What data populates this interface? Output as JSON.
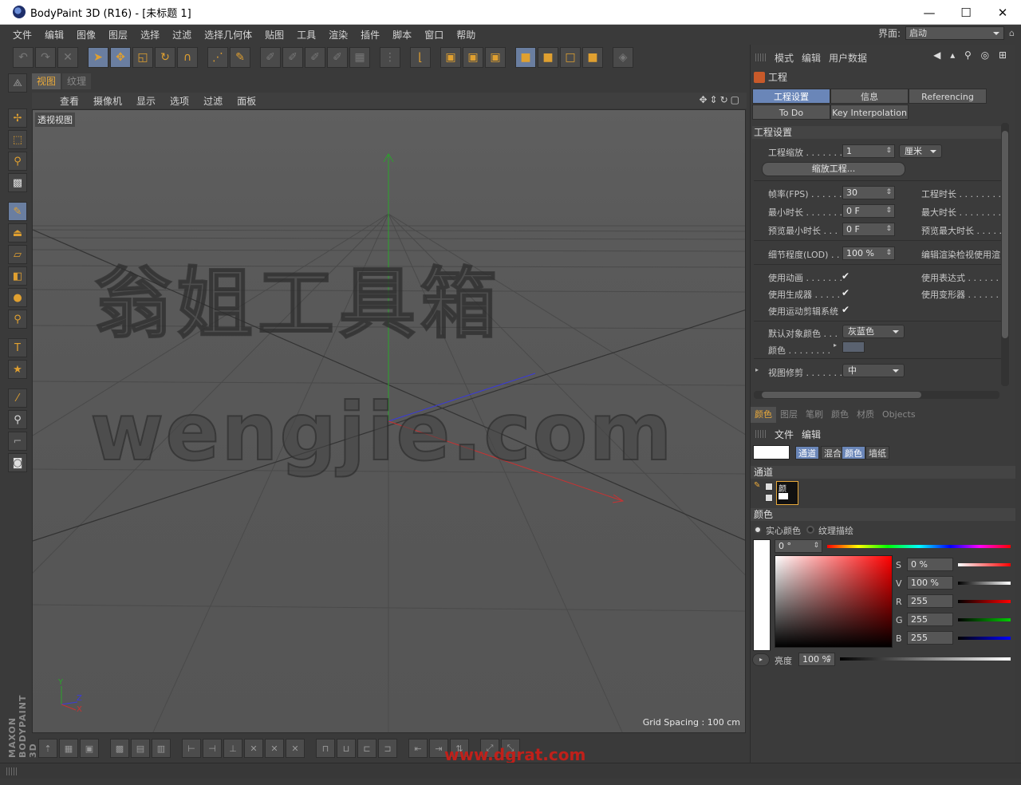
{
  "window": {
    "title": "BodyPaint 3D (R16) - [未标题 1]",
    "minimize": "—",
    "maximize": "☐",
    "close": "✕"
  },
  "menu": [
    "文件",
    "编辑",
    "图像",
    "图层",
    "选择",
    "过滤",
    "选择几何体",
    "贴图",
    "工具",
    "渲染",
    "插件",
    "脚本",
    "窗口",
    "帮助"
  ],
  "layout": {
    "label": "界面:",
    "value": "启动"
  },
  "viewport": {
    "tabs": [
      "视图",
      "纹理"
    ],
    "menu": [
      "查看",
      "摄像机",
      "显示",
      "选项",
      "过滤",
      "面板"
    ],
    "view_label": "透视视图",
    "grid_info": "Grid Spacing : 100 cm",
    "axis": {
      "y": "Y",
      "z": "Z",
      "x": "X"
    }
  },
  "attribute_manager": {
    "header": [
      "模式",
      "编辑",
      "用户数据"
    ],
    "title": "工程",
    "tabs_row1": [
      "工程设置",
      "信息",
      "Referencing"
    ],
    "tabs_row2": [
      "To Do",
      "Key Interpolation"
    ],
    "section": "工程设置",
    "scale_label": "工程缩放 . . . . . . .",
    "scale_value": "1",
    "scale_unit": "厘米",
    "scale_button": "缩放工程...",
    "fps_label": "帧率(FPS) . . . . . .",
    "fps_value": "30",
    "project_time_label": "工程时长 . . . . . . . . .",
    "min_time_label": "最小时长 . . . . . . .",
    "min_time_value": "0 F",
    "max_time_label": "最大时长 . . . . . . . . .",
    "preview_min_label": "预览最小时长 . . .",
    "preview_min_value": "0 F",
    "preview_max_label": "预览最大时长 . . . . .",
    "lod_label": "细节程度(LOD) . .",
    "lod_value": "100 %",
    "render_lod_label": "编辑渲染检视使用渲",
    "use_anim_label": "使用动画 . . . . . . .",
    "use_expr_label": "使用表达式 . . . . . . .",
    "use_gen_label": "使用生成器 . . . . .",
    "use_deform_label": "使用变形器 . . . . . . .",
    "use_motion_label": "使用运动剪辑系统",
    "default_color_label": "默认对象颜色 . . .",
    "default_color_value": "灰蓝色",
    "color_label": "颜色 . . . . . . . .",
    "view_clip_label": "视图修剪 . . . . . . .",
    "view_clip_value": "中"
  },
  "color_panel": {
    "tabs": [
      "颜色",
      "图层",
      "笔刷",
      "颜色",
      "材质",
      "Objects"
    ],
    "menu": [
      "文件",
      "编辑"
    ],
    "modes": [
      "通道",
      "混合",
      "颜色",
      "墙纸"
    ],
    "channel_section": "通道",
    "channel_thumb_label": "颜",
    "color_section": "颜色",
    "radio_solid": "实心颜色",
    "radio_texture": "纹理描绘",
    "hue": "0 °",
    "s_label": "S",
    "s_value": "0 %",
    "v_label": "V",
    "v_value": "100 %",
    "r_label": "R",
    "r_value": "255",
    "g_label": "G",
    "g_value": "255",
    "b_label": "B",
    "b_value": "255",
    "brightness_label": "亮度",
    "brightness_value": "100 %"
  },
  "watermark": {
    "line1": "翁姐工具箱",
    "line2": "wengjie.com",
    "site": "www.dgrat.com"
  },
  "branding": "MAXON BODYPAINT 3D"
}
